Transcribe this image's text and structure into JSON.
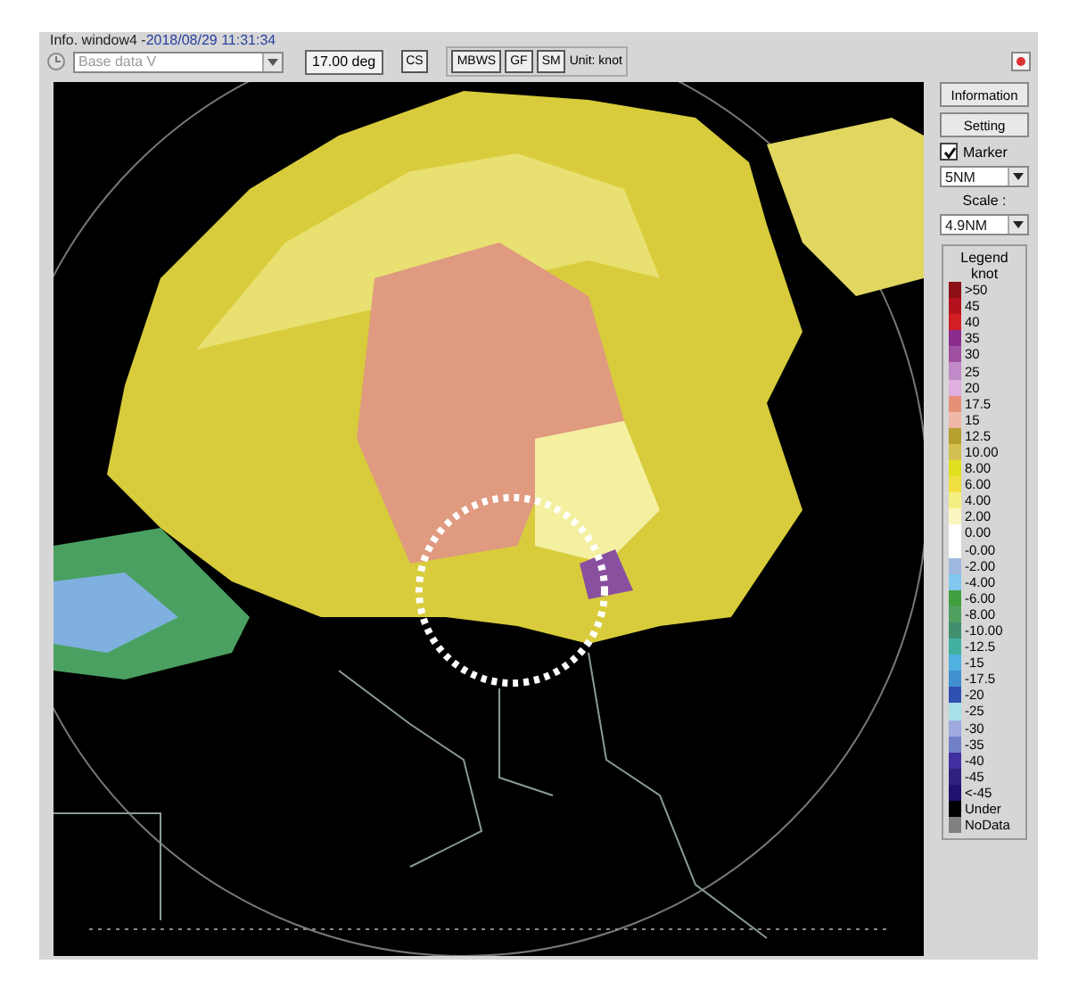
{
  "window": {
    "title": "Info. window4 - ",
    "datetime": "2018/08/29 11:31:34"
  },
  "toolbar": {
    "data_select": {
      "value": "Base data V",
      "disabled": true
    },
    "angle": "17.00 deg",
    "buttons": [
      "CS",
      "MBWS",
      "GF",
      "SM"
    ],
    "unit": "Unit: knot"
  },
  "side_panel": {
    "buttons": [
      "Information",
      "Setting"
    ],
    "marker": {
      "label": "Marker",
      "checked": true
    },
    "range_select": "5NM",
    "scale_label": "Scale :",
    "scale_select": "4.9NM"
  },
  "legend": {
    "title": "Legend",
    "unit": "knot",
    "items": [
      {
        "label": ">50",
        "color": "#8b0f14"
      },
      {
        "label": "45",
        "color": "#b3121c"
      },
      {
        "label": "40",
        "color": "#d41e26"
      },
      {
        "label": "35",
        "color": "#8c2d8e"
      },
      {
        "label": "30",
        "color": "#a050a0"
      },
      {
        "label": "25",
        "color": "#c08ac8"
      },
      {
        "label": "20",
        "color": "#e0b0e0"
      },
      {
        "label": "17.5",
        "color": "#e6907a"
      },
      {
        "label": "15",
        "color": "#efb8a8"
      },
      {
        "label": "12.5",
        "color": "#b8a030"
      },
      {
        "label": "10.00",
        "color": "#d4c050"
      },
      {
        "label": "8.00",
        "color": "#e0e020"
      },
      {
        "label": "6.00",
        "color": "#f0e040"
      },
      {
        "label": "4.00",
        "color": "#f5ef80"
      },
      {
        "label": "2.00",
        "color": "#faf6c0"
      },
      {
        "label": "0.00",
        "color": "#ffffff"
      },
      {
        "label": "-0.00",
        "color": "#ffffff"
      },
      {
        "label": "-2.00",
        "color": "#a0b8e0"
      },
      {
        "label": "-4.00",
        "color": "#80c8f0"
      },
      {
        "label": "-6.00",
        "color": "#40a040"
      },
      {
        "label": "-8.00",
        "color": "#50a060"
      },
      {
        "label": "-10.00",
        "color": "#409070"
      },
      {
        "label": "-12.5",
        "color": "#40b0a0"
      },
      {
        "label": "-15",
        "color": "#50b0e0"
      },
      {
        "label": "-17.5",
        "color": "#4090d0"
      },
      {
        "label": "-20",
        "color": "#3050b0"
      },
      {
        "label": "-25",
        "color": "#a8e0e8"
      },
      {
        "label": "-30",
        "color": "#a0a8e0"
      },
      {
        "label": "-35",
        "color": "#7080c8"
      },
      {
        "label": "-40",
        "color": "#4030a0"
      },
      {
        "label": "-45",
        "color": "#302080"
      },
      {
        "label": "<-45",
        "color": "#201070"
      },
      {
        "label": "Under",
        "color": "#000000"
      },
      {
        "label": "NoData",
        "color": "#808080"
      }
    ]
  }
}
